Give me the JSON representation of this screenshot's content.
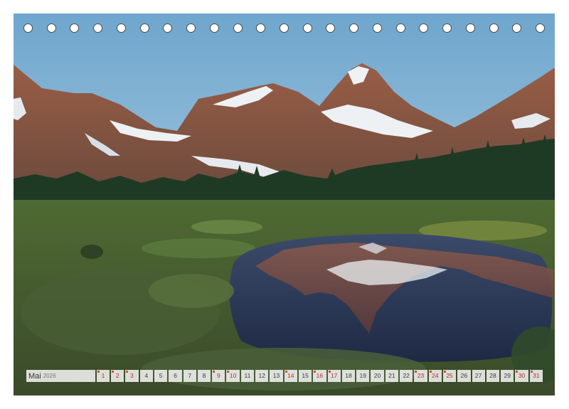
{
  "calendar": {
    "month": "Mai",
    "year": "2026",
    "days": [
      {
        "label": "1",
        "marked": true
      },
      {
        "label": "2",
        "marked": true
      },
      {
        "label": "3",
        "marked": true
      },
      {
        "label": "4",
        "marked": false
      },
      {
        "label": "5",
        "marked": false
      },
      {
        "label": "6",
        "marked": false
      },
      {
        "label": "7",
        "marked": false
      },
      {
        "label": "8",
        "marked": false
      },
      {
        "label": "9",
        "marked": true
      },
      {
        "label": "10",
        "marked": true
      },
      {
        "label": "11",
        "marked": false
      },
      {
        "label": "12",
        "marked": false
      },
      {
        "label": "13",
        "marked": false
      },
      {
        "label": "14",
        "marked": true
      },
      {
        "label": "15",
        "marked": false
      },
      {
        "label": "16",
        "marked": true
      },
      {
        "label": "17",
        "marked": true
      },
      {
        "label": "18",
        "marked": false
      },
      {
        "label": "19",
        "marked": false
      },
      {
        "label": "20",
        "marked": false
      },
      {
        "label": "21",
        "marked": false
      },
      {
        "label": "22",
        "marked": false
      },
      {
        "label": "23",
        "marked": true
      },
      {
        "label": "24",
        "marked": true
      },
      {
        "label": "25",
        "marked": true
      },
      {
        "label": "26",
        "marked": false
      },
      {
        "label": "27",
        "marked": false
      },
      {
        "label": "28",
        "marked": false
      },
      {
        "label": "29",
        "marked": false
      },
      {
        "label": "30",
        "marked": true
      },
      {
        "label": "31",
        "marked": true
      }
    ]
  },
  "binding": {
    "hole_count": 23
  },
  "colors": {
    "sky_top": "#6fa6cd",
    "sky_bottom": "#c4dcea",
    "rock": "#8a5a44",
    "snow": "#f1f3f6",
    "forest": "#1f3a24",
    "meadow": "#5f6f35",
    "water": "#2a3550",
    "weekend_red": "#b0322e"
  }
}
